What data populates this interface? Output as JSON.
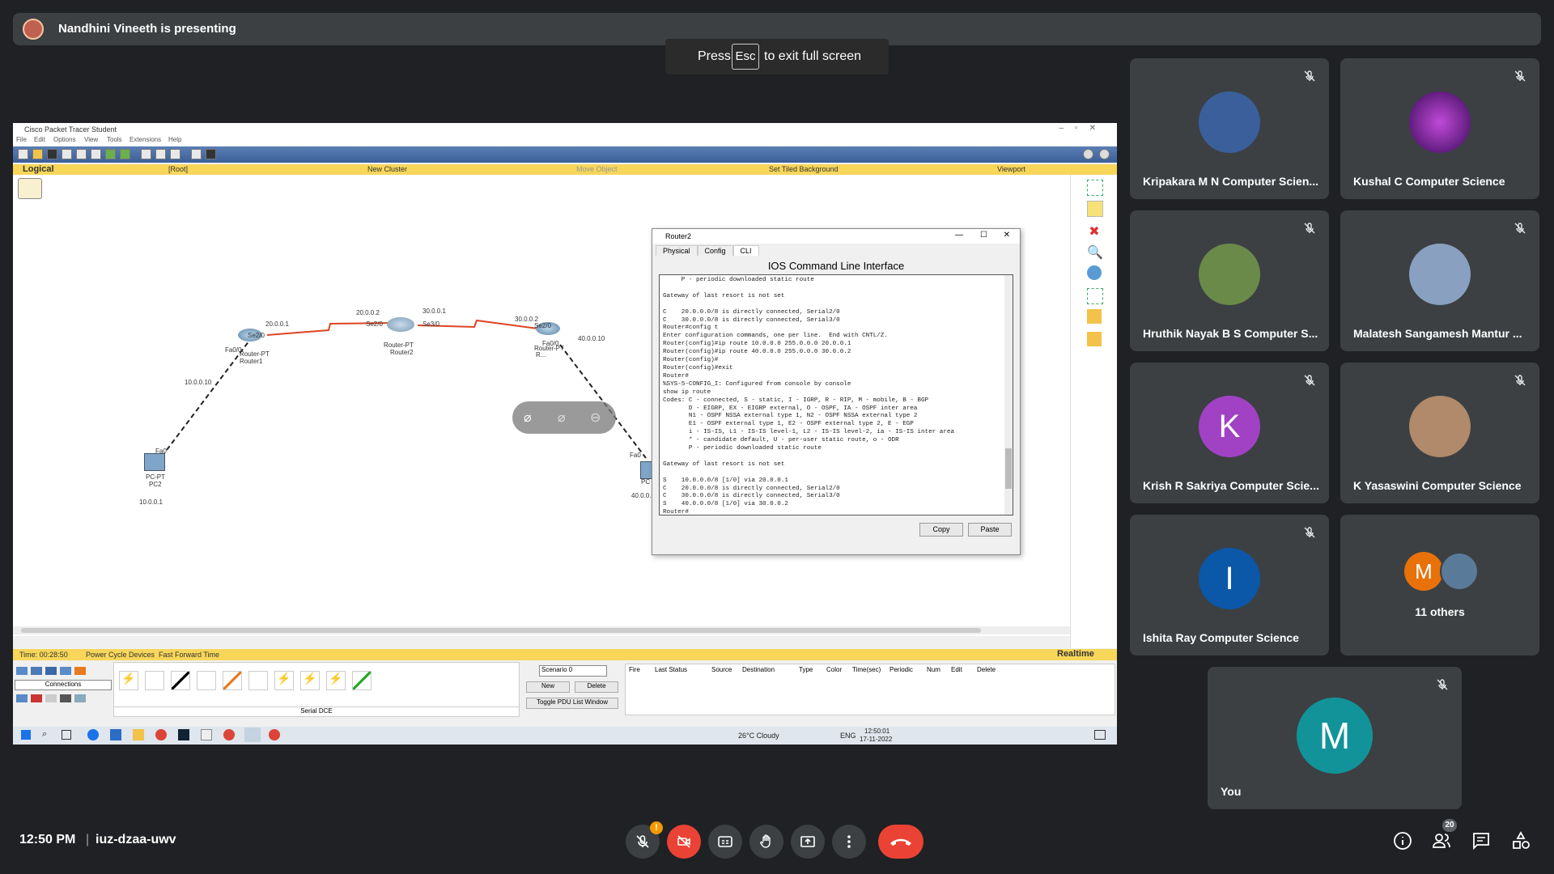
{
  "banner": {
    "presenter_text": "Nandhini Vineeth is presenting"
  },
  "esc_hint": {
    "before": "Press",
    "key": "Esc",
    "after": "to exit full screen"
  },
  "packet_tracer": {
    "window_title": "Cisco Packet Tracer Student",
    "menu": [
      "File",
      "Edit",
      "Options",
      "View",
      "Tools",
      "Extensions",
      "Help"
    ],
    "nav": {
      "logical": "Logical",
      "root": "[Root]",
      "new_cluster": "New Cluster",
      "move_object": "Move Object",
      "tiled_bg": "Set Tiled Background",
      "viewport": "Viewport"
    },
    "devices": {
      "router1": {
        "type": "Router-PT",
        "name": "Router1"
      },
      "router2": {
        "type": "Router-PT",
        "name": "Router2"
      },
      "router3": {
        "type": "Router-PT",
        "name": "R..."
      },
      "pc2": {
        "type": "PC-PT",
        "name": "PC2",
        "ip": "10.0.0.1",
        "port": "Fa0"
      },
      "pc_right": {
        "type": "PC",
        "name": "PC",
        "ip": "40.0.0..."
      }
    },
    "link_labels": {
      "l1": "10.0.0.10",
      "l2": "Fa0/0",
      "l3": "Se2/0",
      "l4": "20.0.0.1",
      "l5": "20.0.0.2",
      "l6": "Se2/0",
      "l7": "30.0.0.1",
      "l8": "Se3/0",
      "l9": "30.0.0.2",
      "l10": "Se2/0",
      "l11": "Fa0/0",
      "l12": "40.0.0.10",
      "l13": "Fa0"
    },
    "status": {
      "time": "Time: 00:28:50",
      "power": "Power Cycle Devices",
      "fast": "Fast Forward Time",
      "mode": "Realtime"
    },
    "bottom": {
      "connections_label": "Connections",
      "serial_label": "Serial DCE",
      "scenario": "Scenario 0",
      "new_btn": "New",
      "delete_btn": "Delete",
      "toggle_btn": "Toggle PDU List Window",
      "pdu_columns": [
        "Fire",
        "Last Status",
        "Source",
        "Destination",
        "Type",
        "Color",
        "Time(sec)",
        "Periodic",
        "Num",
        "Edit",
        "Delete"
      ]
    },
    "taskbar": {
      "weather": "26°C Cloudy",
      "lang": "ENG",
      "time": "12:50:01",
      "date": "17-11-2022"
    }
  },
  "router_window": {
    "title": "Router2",
    "tabs": [
      "Physical",
      "Config",
      "CLI"
    ],
    "heading": "IOS Command Line Interface",
    "cli_text": "     P - periodic downloaded static route\n\nGateway of last resort is not set\n\nC    20.0.0.0/8 is directly connected, Serial2/0\nC    30.0.0.0/8 is directly connected, Serial3/0\nRouter#config t\nEnter configuration commands, one per line.  End with CNTL/Z.\nRouter(config)#ip route 10.0.0.0 255.0.0.0 20.0.0.1\nRouter(config)#ip route 40.0.0.0 255.0.0.0 30.0.0.2\nRouter(config)#\nRouter(config)#exit\nRouter#\n%SYS-5-CONFIG_I: Configured from console by console\nshow ip route\nCodes: C - connected, S - static, I - IGRP, R - RIP, M - mobile, B - BGP\n       D - EIGRP, EX - EIGRP external, O - OSPF, IA - OSPF inter area\n       N1 - OSPF NSSA external type 1, N2 - OSPF NSSA external type 2\n       E1 - OSPF external type 1, E2 - OSPF external type 2, E - EGP\n       i - IS-IS, L1 - IS-IS level-1, L2 - IS-IS level-2, ia - IS-IS inter area\n       * - candidate default, U - per-user static route, o - ODR\n       P - periodic downloaded static route\n\nGateway of last resort is not set\n\nS    10.0.0.0/8 [1/0] via 20.0.0.1\nC    20.0.0.0/8 is directly connected, Serial2/0\nC    30.0.0.0/8 is directly connected, Serial3/0\nS    40.0.0.0/8 [1/0] via 30.0.0.2\nRouter#",
    "copy_btn": "Copy",
    "paste_btn": "Paste"
  },
  "participants": [
    {
      "name": "Kripakara M N Computer Scien...",
      "avatar": "photo",
      "color": "#3a5f9a"
    },
    {
      "name": "Kushal C Computer Science",
      "avatar": "photo",
      "color": "#5a1a8a"
    },
    {
      "name": "Hruthik Nayak B S Computer S...",
      "avatar": "photo",
      "color": "#6a8a4a"
    },
    {
      "name": "Malatesh Sangamesh Mantur ...",
      "avatar": "photo",
      "color": "#8aa0c0"
    },
    {
      "name": "Krish R Sakriya Computer Scie...",
      "avatar": "K",
      "color": "#a142c4"
    },
    {
      "name": "K Yasaswini Computer Science",
      "avatar": "photo",
      "color": "#b08a6a"
    },
    {
      "name": "Ishita Ray Computer Science",
      "avatar": "I",
      "color": "#0b57a8"
    },
    {
      "name": "11 others",
      "avatar": "M",
      "color": "#e8710a"
    },
    {
      "name": "You",
      "avatar": "M",
      "color": "#12939a"
    }
  ],
  "footer": {
    "time": "12:50 PM",
    "separator": "|",
    "meeting_code": "iuz-dzaa-uwv",
    "people_count": "20"
  }
}
